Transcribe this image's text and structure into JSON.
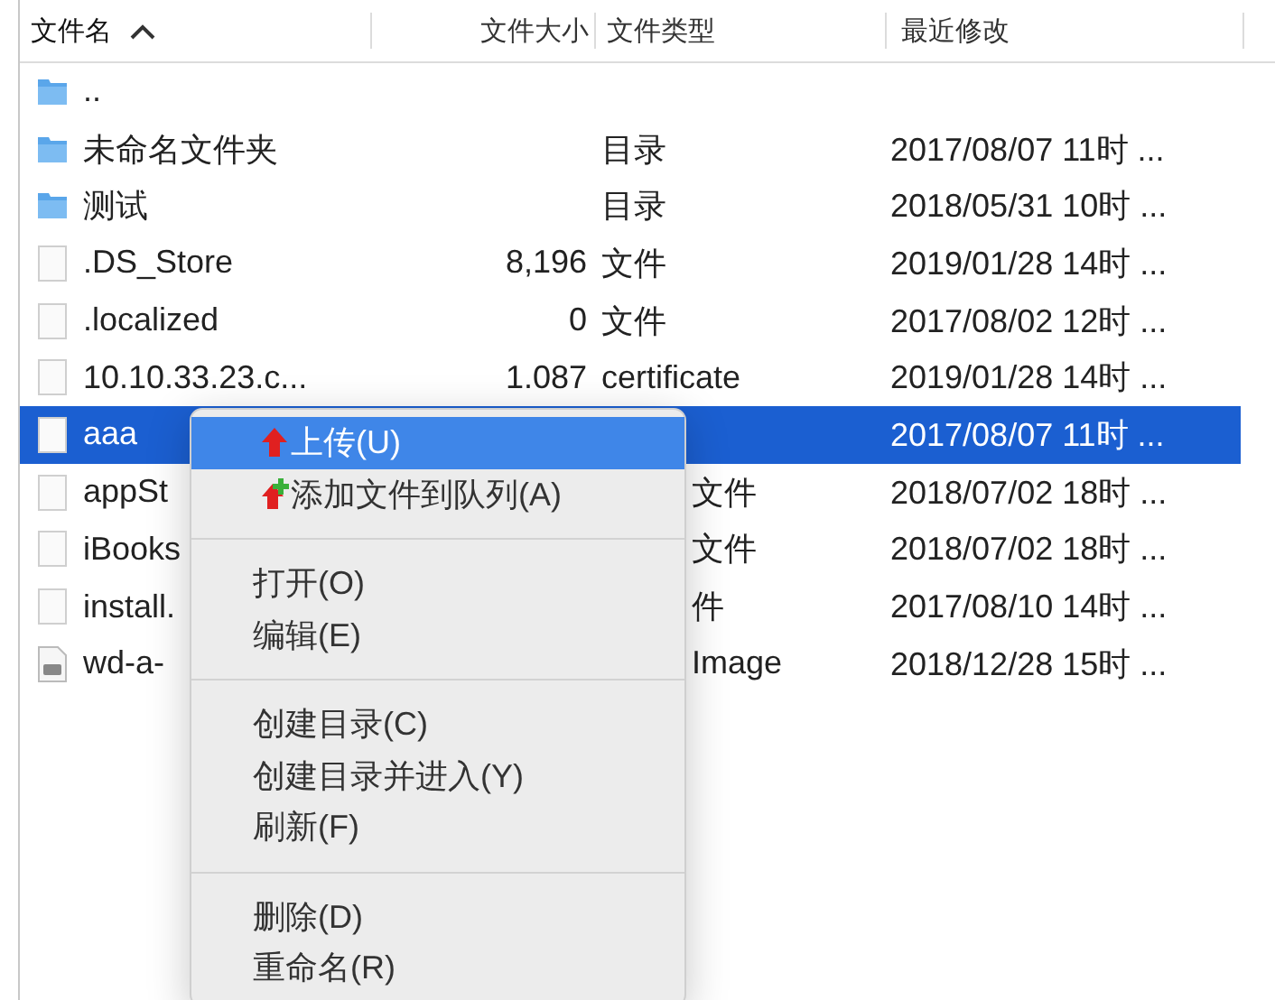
{
  "table": {
    "columns": [
      {
        "label": "文件名",
        "sorted": true
      },
      {
        "label": "文件大小",
        "sorted": false
      },
      {
        "label": "文件类型",
        "sorted": false
      },
      {
        "label": "最近修改",
        "sorted": false
      }
    ],
    "rows": [
      {
        "kind": "folder",
        "name": "..",
        "selected": false
      },
      {
        "kind": "folder",
        "name": "未命名文件夹",
        "type": "目录",
        "modified": "2017/08/07 11时 ...",
        "selected": false
      },
      {
        "kind": "folder",
        "name": "测试",
        "type": "目录",
        "modified": "2018/05/31 10时 ...",
        "selected": false
      },
      {
        "kind": "file",
        "name": ".DS_Store",
        "size": "8,196",
        "type": "文件",
        "modified": "2019/01/28 14时 ...",
        "selected": false
      },
      {
        "kind": "file",
        "name": ".localized",
        "size": "0",
        "type": "文件",
        "modified": "2017/08/02 12时 ...",
        "selected": false
      },
      {
        "kind": "file",
        "name": "10.10.33.23.c...",
        "size": "1.087",
        "type": "certificate",
        "modified": "2019/01/28 14时 ...",
        "selected": false
      },
      {
        "kind": "file",
        "name": "aaa",
        "modified": "2017/08/07 11时 ...",
        "selected": true
      },
      {
        "kind": "file",
        "name": "appSt",
        "type": "文件",
        "modified": "2018/07/02 18时 ...",
        "selected": false
      },
      {
        "kind": "file",
        "name": "iBooks",
        "type": "文件",
        "modified": "2018/07/02 18时 ...",
        "selected": false
      },
      {
        "kind": "file",
        "name": "install.",
        "type": "件",
        "modified": "2017/08/10 14时 ...",
        "selected": false
      },
      {
        "kind": "disk",
        "name": "wd-a-",
        "type": "Image",
        "modified": "2018/12/28 15时 ...",
        "selected": false
      }
    ]
  },
  "context_menu": {
    "items": [
      {
        "kind": "upload",
        "label": "上传(U)",
        "selected": true
      },
      {
        "kind": "queue",
        "label": "添加文件到队列(A)",
        "selected": false
      },
      {
        "kind": "separator"
      },
      {
        "kind": "item",
        "label": "打开(O)",
        "selected": false
      },
      {
        "kind": "item",
        "label": "编辑(E)",
        "selected": false
      },
      {
        "kind": "separator"
      },
      {
        "kind": "item",
        "label": "创建目录(C)",
        "selected": false
      },
      {
        "kind": "item",
        "label": "创建目录并进入(Y)",
        "selected": false
      },
      {
        "kind": "item",
        "label": "刷新(F)",
        "selected": false
      },
      {
        "kind": "separator"
      },
      {
        "kind": "item",
        "label": "删除(D)",
        "selected": false
      },
      {
        "kind": "item",
        "label": "重命名(R)",
        "selected": false
      }
    ]
  }
}
